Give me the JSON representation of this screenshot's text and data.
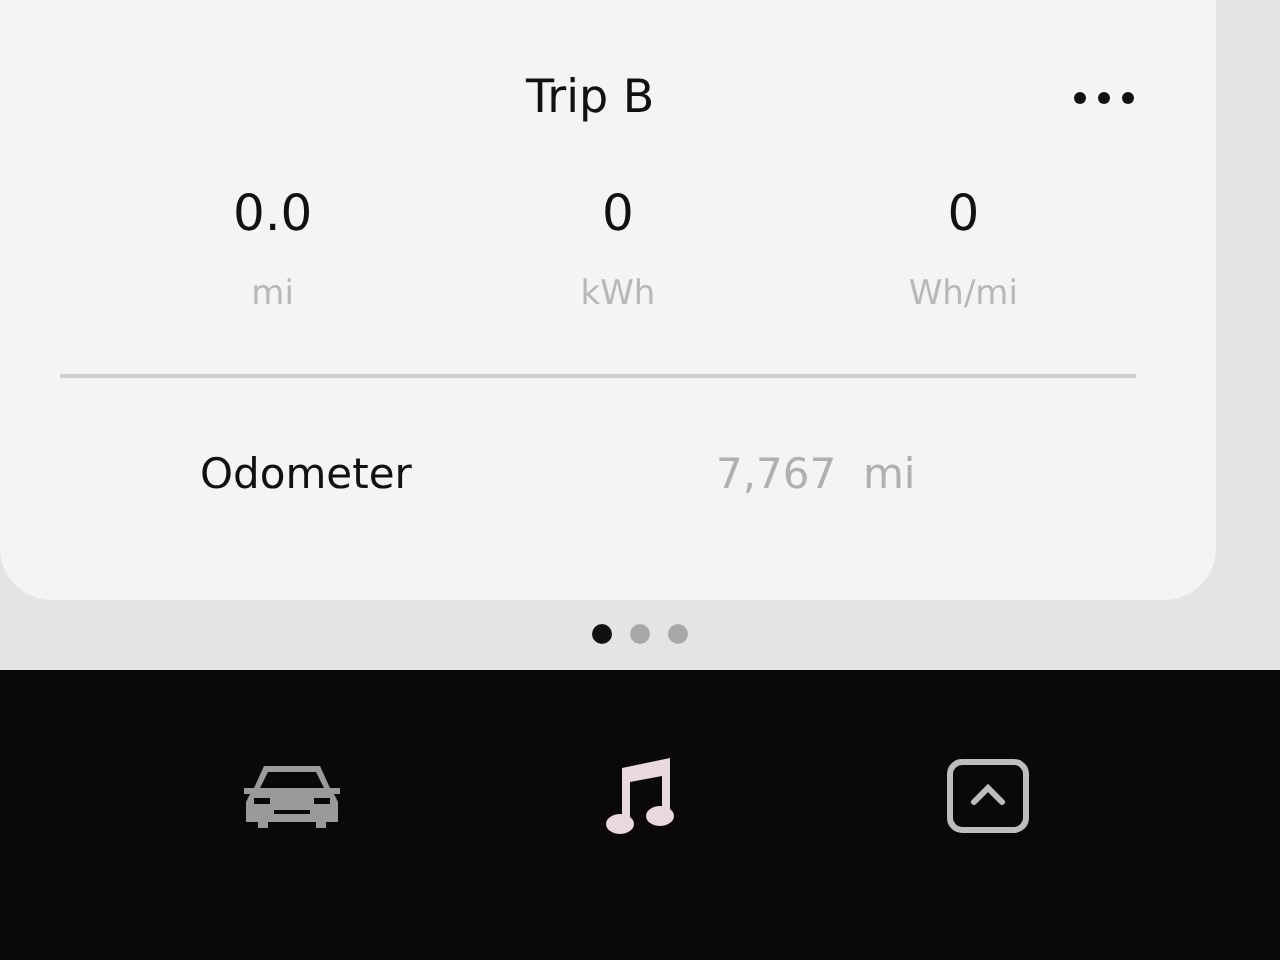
{
  "card": {
    "title": "Trip B",
    "stats": [
      {
        "value": "0.0",
        "unit": "mi"
      },
      {
        "value": "0",
        "unit": "kWh"
      },
      {
        "value": "0",
        "unit": "Wh/mi"
      }
    ],
    "odometer": {
      "label": "Odometer",
      "value": "7,767  mi"
    }
  },
  "page_dots": [
    {
      "selected": true
    },
    {
      "selected": false
    },
    {
      "selected": false
    }
  ],
  "dock": [
    {
      "kind": "car"
    },
    {
      "kind": "music"
    },
    {
      "kind": "up"
    }
  ]
}
